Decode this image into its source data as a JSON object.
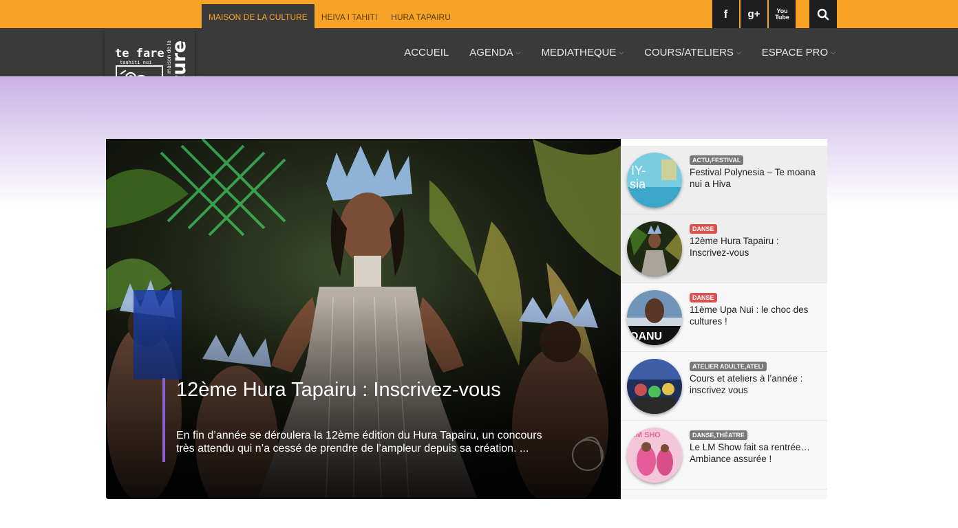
{
  "topnav": {
    "items": [
      {
        "label": "MAISON DE LA CULTURE",
        "active": true
      },
      {
        "label": "HEIVA I TAHITI",
        "active": false
      },
      {
        "label": "HURA TAPAIRU",
        "active": false
      }
    ],
    "social_icons": [
      "facebook-icon",
      "google-plus-icon",
      "youtube-icon"
    ],
    "search_icon": "search-icon"
  },
  "logo": {
    "line1": "te fare",
    "line2": "tauhiti nui",
    "line3": "maison de la",
    "line4": "culture"
  },
  "mainnav": {
    "items": [
      {
        "label": "ACCUEIL",
        "dropdown": false
      },
      {
        "label": "AGENDA",
        "dropdown": true
      },
      {
        "label": "MEDIATHEQUE",
        "dropdown": true
      },
      {
        "label": "COURS/ATELIERS",
        "dropdown": true
      },
      {
        "label": "ESPACE PRO",
        "dropdown": true
      }
    ]
  },
  "featured": {
    "title": "12ème Hura Tapairu : Inscrivez-vous",
    "excerpt": "En fin d’année se déroulera la 12ème édition du Hura Tapairu, un concours très attendu qui n’a cessé de prendre de l’ampleur depuis sa création. ..."
  },
  "sidebar": {
    "items": [
      {
        "badge": "ACTU,FESTIVAL",
        "badge_color": "#777777",
        "title": "Festival Polynesia – Te moana nui a Hiva",
        "active": true
      },
      {
        "badge": "DANSE",
        "badge_color": "#d9534f",
        "title": "12ème Hura Tapairu : Inscrivez-vous",
        "active": true
      },
      {
        "badge": "DANSE",
        "badge_color": "#d9534f",
        "title": "11ème Upa Nui : le choc des cultures !",
        "active": false
      },
      {
        "badge": "ATELIER ADULTE,ATELI",
        "badge_color": "#777777",
        "title": "Cours et ateliers à l’année : inscrivez vous",
        "active": false
      },
      {
        "badge": "DANSE,THÉATRE",
        "badge_color": "#777777",
        "title": "Le LM Show fait sa rentrée… Ambiance assurée !",
        "active": false
      }
    ]
  },
  "colors": {
    "accent": "#f7a426",
    "dark": "#3a3a3a",
    "purple": "#8a5fcf"
  }
}
